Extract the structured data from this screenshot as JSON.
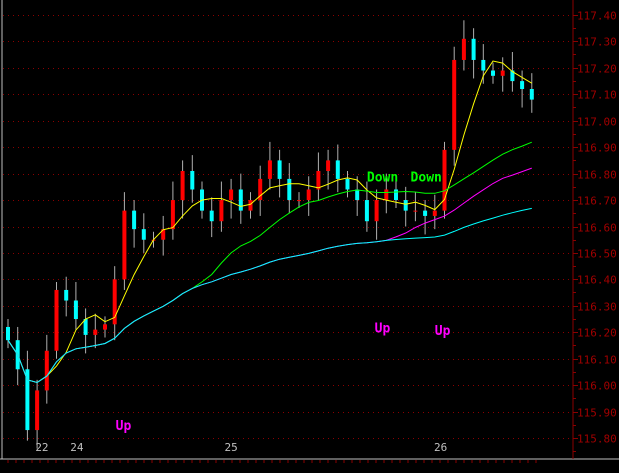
{
  "chart_data": {
    "type": "candlestick",
    "title": "",
    "y_ticks": [
      "117.40",
      "117.30",
      "117.20",
      "117.10",
      "117.00",
      "116.90",
      "116.80",
      "116.70",
      "116.60",
      "116.50",
      "116.40",
      "116.30",
      "116.20",
      "116.10",
      "116.00",
      "115.90",
      "115.80"
    ],
    "ylim": [
      115.77,
      117.45
    ],
    "x_ticks": [
      {
        "label": "22",
        "index": 3.5
      },
      {
        "label": "24",
        "index": 7.1
      },
      {
        "label": "25",
        "index": 23.0
      },
      {
        "label": "26",
        "index": 44.6
      }
    ],
    "closes": [
      116.17,
      116.06,
      115.83,
      115.98,
      116.13,
      116.36,
      116.32,
      116.25,
      116.19,
      116.21,
      116.23,
      116.4,
      116.66,
      116.59,
      116.55,
      116.55,
      116.59,
      116.7,
      116.81,
      116.74,
      116.66,
      116.62,
      116.7,
      116.74,
      116.66,
      116.7,
      116.78,
      116.85,
      116.78,
      116.7,
      116.7,
      116.74,
      116.81,
      116.85,
      116.78,
      116.74,
      116.7,
      116.62,
      116.7,
      116.74,
      116.7,
      116.66,
      116.66,
      116.64,
      116.66,
      116.89,
      117.23,
      117.31,
      117.23,
      117.19,
      117.17,
      117.19,
      117.15,
      117.12,
      117.08
    ],
    "moving_averages": [
      {
        "period": 5,
        "color": "#ffff00"
      },
      {
        "period": 20,
        "color": "#00ff00"
      },
      {
        "period": 40,
        "color": "#ff00ff"
      },
      {
        "period": 80,
        "color": "#00ffff"
      }
    ],
    "annotations": [
      {
        "text": "Up",
        "index": 11.1,
        "price": 115.83,
        "color": "#ff00ff"
      },
      {
        "text": "Down",
        "index": 37.0,
        "price": 116.77,
        "color": "#00ff00"
      },
      {
        "text": "Down",
        "index": 41.5,
        "price": 116.77,
        "color": "#00ff00"
      },
      {
        "text": "Up",
        "index": 37.8,
        "price": 116.2,
        "color": "#ff00ff"
      },
      {
        "text": "Up",
        "index": 44.0,
        "price": 116.19,
        "color": "#ff00ff"
      }
    ],
    "colors": {
      "up": "#ff0000",
      "down": "#00ffff",
      "grid": "#8b0000",
      "axis": "#8b0000",
      "frame": "#c0c0c0"
    }
  }
}
